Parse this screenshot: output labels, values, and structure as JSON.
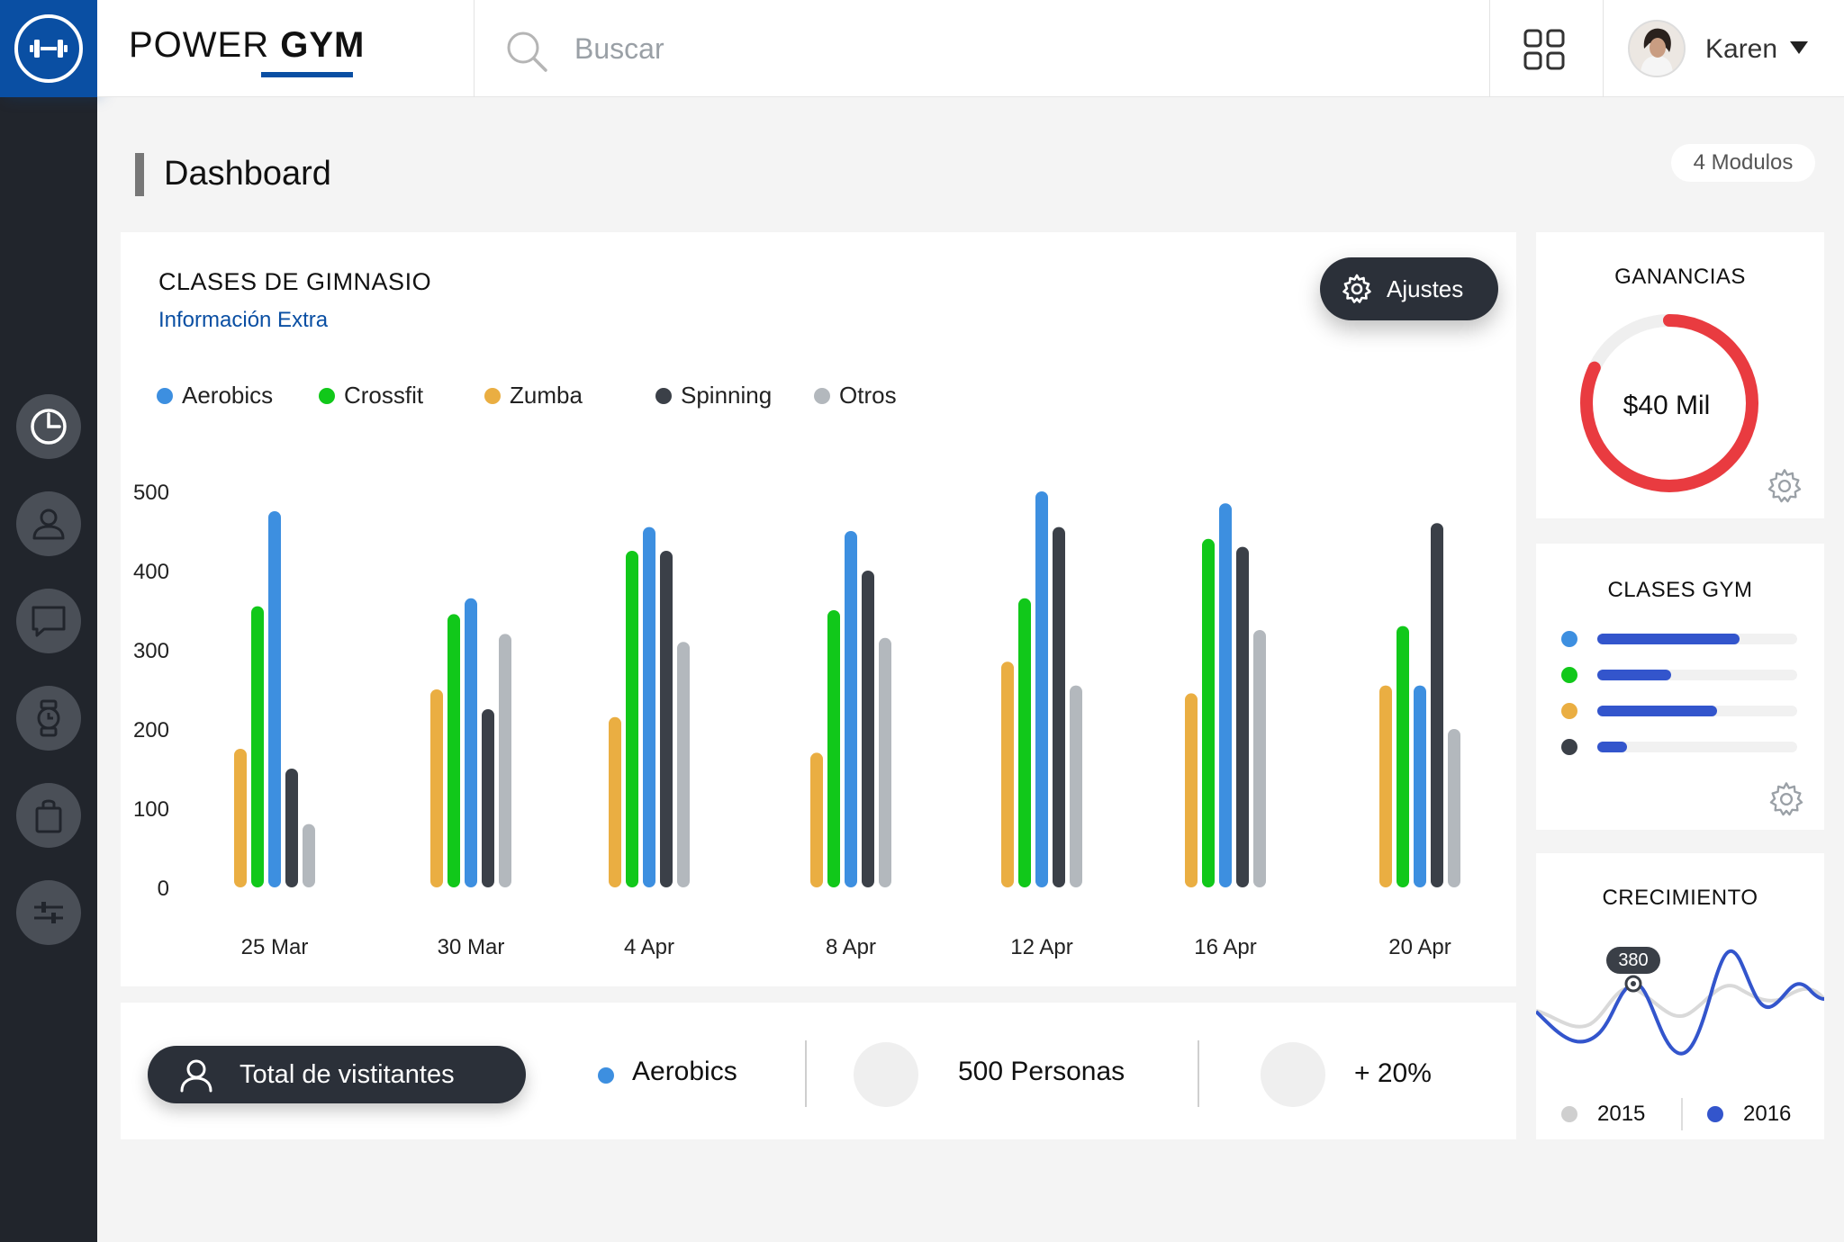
{
  "brand": {
    "prefix": "POWER ",
    "bold": "GYM"
  },
  "search": {
    "placeholder": "Buscar"
  },
  "user": {
    "name": "Karen"
  },
  "page": {
    "title": "Dashboard",
    "modules_badge": "4 Modulos"
  },
  "sidebar": {
    "items": [
      {
        "icon": "dashboard-clock-icon"
      },
      {
        "icon": "user-icon"
      },
      {
        "icon": "chat-icon"
      },
      {
        "icon": "watch-icon"
      },
      {
        "icon": "bag-icon"
      },
      {
        "icon": "sliders-icon"
      }
    ]
  },
  "main_card": {
    "title": "CLASES DE GIMNASIO",
    "subtitle": "Información Extra",
    "settings_label": "Ajustes"
  },
  "colors": {
    "accent": "#0a4fa3",
    "dark_button": "#2b3039",
    "aerobics": "#3d8fe0",
    "crossfit": "#11c81a",
    "zumba": "#eaae42",
    "spinning": "#3b4048",
    "otros": "#b3b8bd",
    "ganancias_ring": "#e93b40",
    "bar_fill": "#3355cc"
  },
  "chart_data": {
    "type": "bar",
    "categories": [
      "25 Mar",
      "30 Mar",
      "4 Apr",
      "8 Apr",
      "12 Apr",
      "16 Apr",
      "20 Apr"
    ],
    "y_ticks": [
      "500",
      "400",
      "300",
      "200",
      "100",
      "0"
    ],
    "ylim": [
      0,
      500
    ],
    "legend_position": "top-left",
    "series": [
      {
        "name": "Zumba",
        "color": "#eaae42",
        "values": [
          175,
          250,
          215,
          170,
          285,
          245,
          255
        ]
      },
      {
        "name": "Crossfit",
        "color": "#11c81a",
        "values": [
          355,
          345,
          425,
          350,
          365,
          440,
          330
        ]
      },
      {
        "name": "Aerobics",
        "color": "#3d8fe0",
        "values": [
          475,
          365,
          455,
          450,
          500,
          485,
          255
        ]
      },
      {
        "name": "Spinning",
        "color": "#3b4048",
        "values": [
          150,
          225,
          425,
          400,
          455,
          430,
          460
        ]
      },
      {
        "name": "Otros",
        "color": "#b3b8bd",
        "values": [
          80,
          320,
          310,
          315,
          255,
          325,
          200
        ]
      }
    ]
  },
  "visitors": {
    "button_label": "Total de vistitantes",
    "category": "Aerobics",
    "people": "500 Personas",
    "growth": "+ 20%"
  },
  "ganancias": {
    "title": "GANANCIAS",
    "value": "$40 Mil",
    "fraction": 0.82
  },
  "clases_gym": {
    "title": "CLASES GYM",
    "rows": [
      {
        "color": "#3d8fe0",
        "fraction": 0.71
      },
      {
        "color": "#11c81a",
        "fraction": 0.37
      },
      {
        "color": "#eaae42",
        "fraction": 0.6
      },
      {
        "color": "#3b4048",
        "fraction": 0.15
      }
    ]
  },
  "crecimiento": {
    "title": "CRECIMIENTO",
    "tooltip": "380",
    "legend": [
      {
        "label": "2015",
        "color": "#cfcfcf"
      },
      {
        "label": "2016",
        "color": "#3355cc"
      }
    ]
  }
}
